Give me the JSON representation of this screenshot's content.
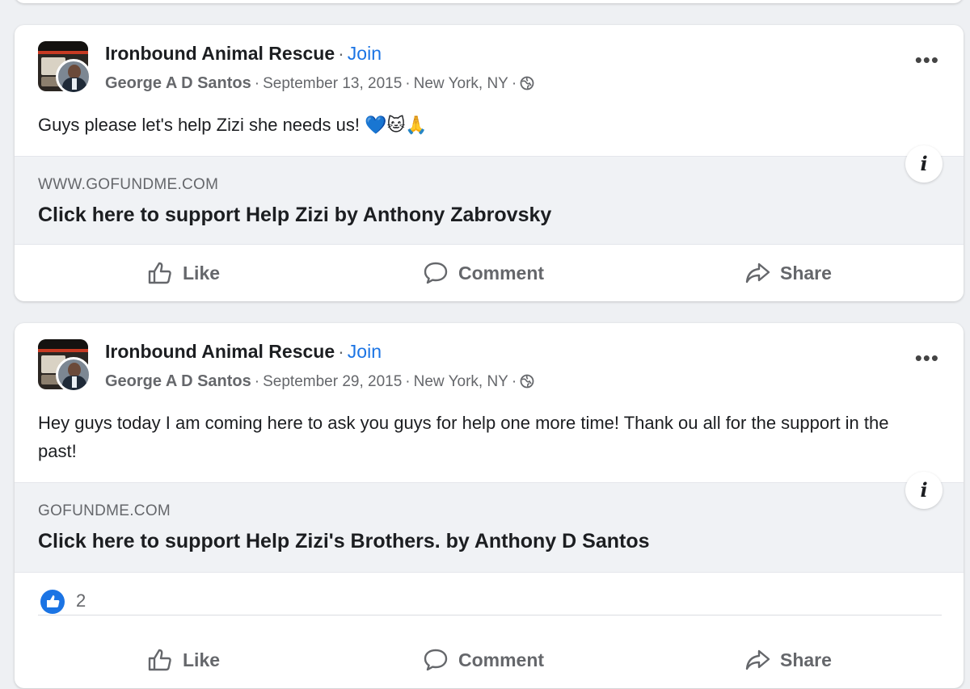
{
  "posts": [
    {
      "group_name": "Ironbound Animal Rescue",
      "separator": "·",
      "join_label": "Join",
      "author": "George A D Santos",
      "date": "September 13, 2015",
      "location": "New York, NY",
      "privacy_icon": "globe-icon",
      "more_icon": "•••",
      "text": "Guys please let's help Zizi she needs us! 💙🐱🙏",
      "link_domain": "WWW.GOFUNDME.COM",
      "link_title": "Click here to support Help Zizi by Anthony Zabrovsky",
      "info_icon": "i",
      "actions": {
        "like": "Like",
        "comment": "Comment",
        "share": "Share"
      }
    },
    {
      "group_name": "Ironbound Animal Rescue",
      "separator": "·",
      "join_label": "Join",
      "author": "George A D Santos",
      "date": "September 29, 2015",
      "location": "New York, NY",
      "privacy_icon": "globe-icon",
      "more_icon": "•••",
      "text": "Hey guys today I am coming here to ask you guys for help one more time! Thank ou all for the support in the past!",
      "link_domain": "GOFUNDME.COM",
      "link_title": "Click here to support Help Zizi's Brothers. by Anthony D Santos",
      "info_icon": "i",
      "reaction_count": "2",
      "actions": {
        "like": "Like",
        "comment": "Comment",
        "share": "Share"
      }
    }
  ],
  "colors": {
    "accent": "#1b74e4",
    "secondary_text": "#65676b",
    "background": "#eef0f3"
  }
}
